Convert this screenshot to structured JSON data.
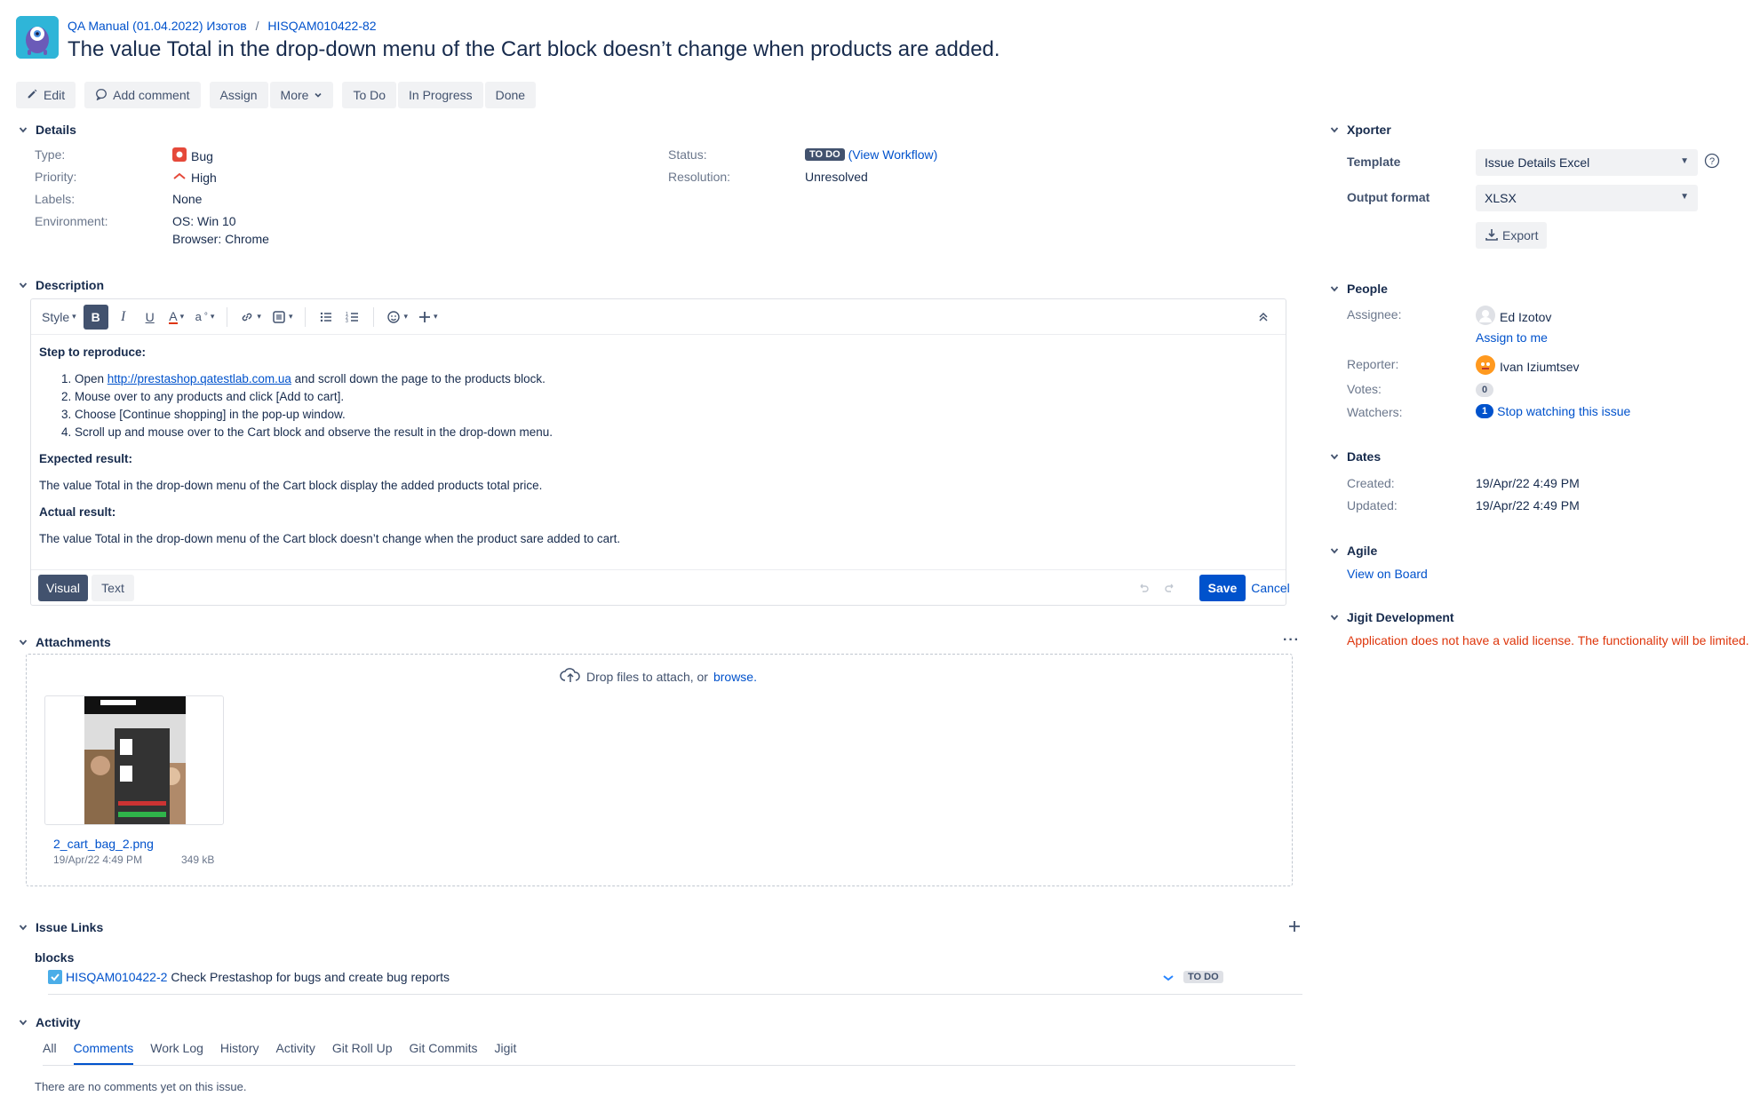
{
  "header": {
    "project": "QA Manual (01.04.2022) Изотов",
    "separator": "/",
    "issue_key": "HISQAM010422-82",
    "title": "The value Total in the drop-down menu of the Cart block doesn’t change when products are added."
  },
  "toolbar": {
    "edit": "Edit",
    "add_comment": "Add comment",
    "assign": "Assign",
    "more": "More",
    "todo": "To Do",
    "in_progress": "In Progress",
    "done": "Done"
  },
  "details": {
    "heading": "Details",
    "type_label": "Type:",
    "type_value": "Bug",
    "priority_label": "Priority:",
    "priority_value": "High",
    "labels_label": "Labels:",
    "labels_value": "None",
    "environment_label": "Environment:",
    "environment_line1": "OS: Win 10",
    "environment_line2": "Browser: Chrome",
    "status_label": "Status:",
    "status_value": "TO DO",
    "view_workflow": "(View Workflow)",
    "resolution_label": "Resolution:",
    "resolution_value": "Unresolved"
  },
  "description": {
    "heading": "Description",
    "style_label": "Style",
    "step_heading": "Step to reproduce:",
    "steps": [
      {
        "prefix": "Open ",
        "link": "http://prestashop.qatestlab.com.ua",
        "suffix": " and scroll down the page to the products block."
      },
      {
        "text": "Mouse over to any products and click [Add to cart]."
      },
      {
        "text": "Choose [Continue shopping] in the pop-up window."
      },
      {
        "text": "Scroll up and mouse over to the Cart block and observe the result in the drop-down menu."
      }
    ],
    "expected_heading": "Expected result:",
    "expected_text": "The value Total in the drop-down menu of the Cart block display the added products total price.",
    "actual_heading": "Actual result:",
    "actual_text": "The value Total in the drop-down menu of the Cart block doesn’t change when the product sare added to cart.",
    "visual_tab": "Visual",
    "text_tab": "Text",
    "save": "Save",
    "cancel": "Cancel"
  },
  "attachments": {
    "heading": "Attachments",
    "drop_text": "Drop files to attach, or",
    "browse": "browse.",
    "file_name": "2_cart_bag_2.png",
    "file_date": "19/Apr/22 4:49 PM",
    "file_size": "349 kB"
  },
  "issue_links": {
    "heading": "Issue Links",
    "relation": "blocks",
    "linked_key": "HISQAM010422-2",
    "linked_summary": "Check Prestashop for bugs and create bug reports",
    "linked_status": "TO DO"
  },
  "activity": {
    "heading": "Activity",
    "tabs": [
      "All",
      "Comments",
      "Work Log",
      "History",
      "Activity",
      "Git Roll Up",
      "Git Commits",
      "Jigit"
    ],
    "selected_tab": "Comments",
    "empty_text": "There are no comments yet on this issue."
  },
  "xporter": {
    "heading": "Xporter",
    "template_label": "Template",
    "template_value": "Issue Details Excel",
    "format_label": "Output format",
    "format_value": "XLSX",
    "export": "Export"
  },
  "people": {
    "heading": "People",
    "assignee_label": "Assignee:",
    "assignee": "Ed Izotov",
    "assign_to_me": "Assign to me",
    "reporter_label": "Reporter:",
    "reporter": "Ivan Iziumtsev",
    "votes_label": "Votes:",
    "votes": "0",
    "watchers_label": "Watchers:",
    "watchers": "1",
    "stop_watching": "Stop watching this issue"
  },
  "dates": {
    "heading": "Dates",
    "created_label": "Created:",
    "created": "19/Apr/22 4:49 PM",
    "updated_label": "Updated:",
    "updated": "19/Apr/22 4:49 PM"
  },
  "agile": {
    "heading": "Agile",
    "view_on_board": "View on Board"
  },
  "jigit": {
    "heading": "Jigit Development",
    "warning": "Application does not have a valid license. The functionality will be limited.",
    "warning_color": "#de350b"
  },
  "colors": {
    "link": "#0052cc",
    "primary_button": "#0052cc",
    "text": "#172b4d",
    "muted": "#6b778c"
  },
  "icons": [
    "project-avatar-icon",
    "pencil-icon",
    "comment-icon",
    "chevron-down-icon",
    "bug-icon",
    "priority-high-icon",
    "bold-icon",
    "italic-icon",
    "underline-icon",
    "text-color-icon",
    "link-icon",
    "attachment-icon",
    "bullet-list-icon",
    "numbered-list-icon",
    "emoji-icon",
    "plus-icon",
    "collapse-icon",
    "undo-icon",
    "redo-icon",
    "cloud-upload-icon",
    "more-icon",
    "checkbox-icon",
    "help-icon",
    "download-icon",
    "avatar-icon"
  ]
}
